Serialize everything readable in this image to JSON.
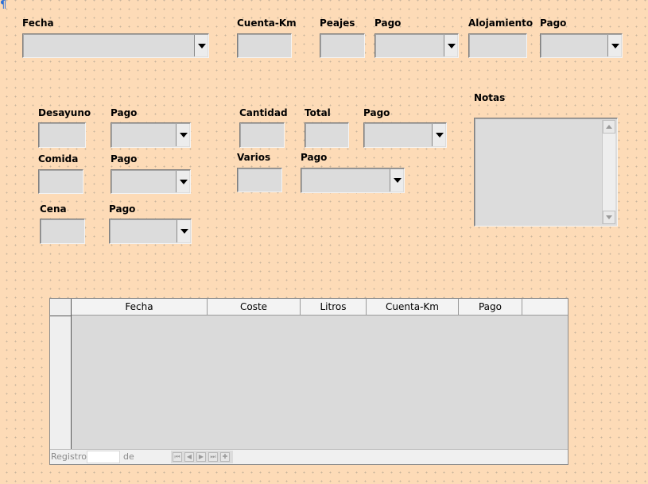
{
  "labels": {
    "fecha": "Fecha",
    "cuenta_km": "Cuenta-Km",
    "peajes": "Peajes",
    "pago_peajes": "Pago",
    "alojamiento": "Alojamiento",
    "pago_alojamiento": "Pago",
    "desayuno": "Desayuno",
    "pago_desayuno": "Pago",
    "comida": "Comida",
    "pago_comida": "Pago",
    "cena": "Cena",
    "pago_cena": "Pago",
    "cantidad": "Cantidad",
    "total": "Total",
    "pago_total": "Pago",
    "varios": "Varios",
    "pago_varios": "Pago",
    "notas": "Notas"
  },
  "grid": {
    "columns": [
      "Fecha",
      "Coste",
      "Litros",
      "Cuenta-Km",
      "Pago"
    ]
  },
  "navigator": {
    "record_label": "Registro",
    "of_label": "de",
    "first": "⏮",
    "prev": "◀",
    "next": "▶",
    "last": "⏭",
    "new": "✚"
  },
  "colors": {
    "background": "#fddbb7",
    "field": "#dcdcdc",
    "anchor": "#2a6fd6"
  }
}
